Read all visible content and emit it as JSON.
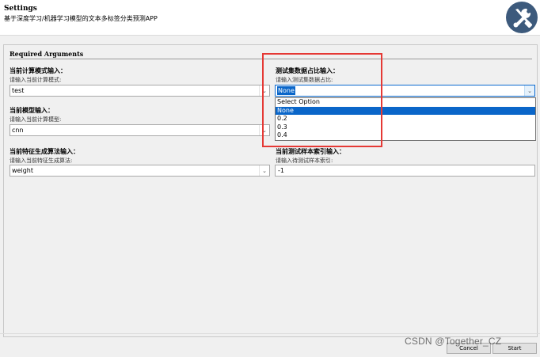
{
  "header": {
    "title": "Settings",
    "subtitle": "基于深度学习/机器学习模型的文本多标签分类预测APP",
    "logo_icon": "tools-icon",
    "logo_color": "#3d5a7c"
  },
  "section": {
    "title": "Required Arguments"
  },
  "fields": {
    "mode": {
      "label": "当前计算模式输入：",
      "help": "请输入当前计算模式:",
      "value": "test"
    },
    "model": {
      "label": "当前模型输入：",
      "help": "请输入当前计算模型:",
      "value": "cnn"
    },
    "feature": {
      "label": "当前特征生成算法输入：",
      "help": "请输入当前特征生成算法:",
      "value": "weight"
    },
    "ratio": {
      "label": "测试集数据占比输入：",
      "help": "请输入测试集数据占比:",
      "value": "None",
      "options": [
        "Select Option",
        "None",
        "0.2",
        "0.3",
        "0.4"
      ],
      "highlighted": "None"
    },
    "index": {
      "label": "当前测试样本索引输入：",
      "help": "请输入待测试样本索引:",
      "value": "-1"
    }
  },
  "buttons": {
    "cancel": "Cancel",
    "start": "Start"
  },
  "watermark": "CSDN @Together_CZ",
  "colors": {
    "highlight_box": "#e53935",
    "selection": "#0a66c9"
  }
}
